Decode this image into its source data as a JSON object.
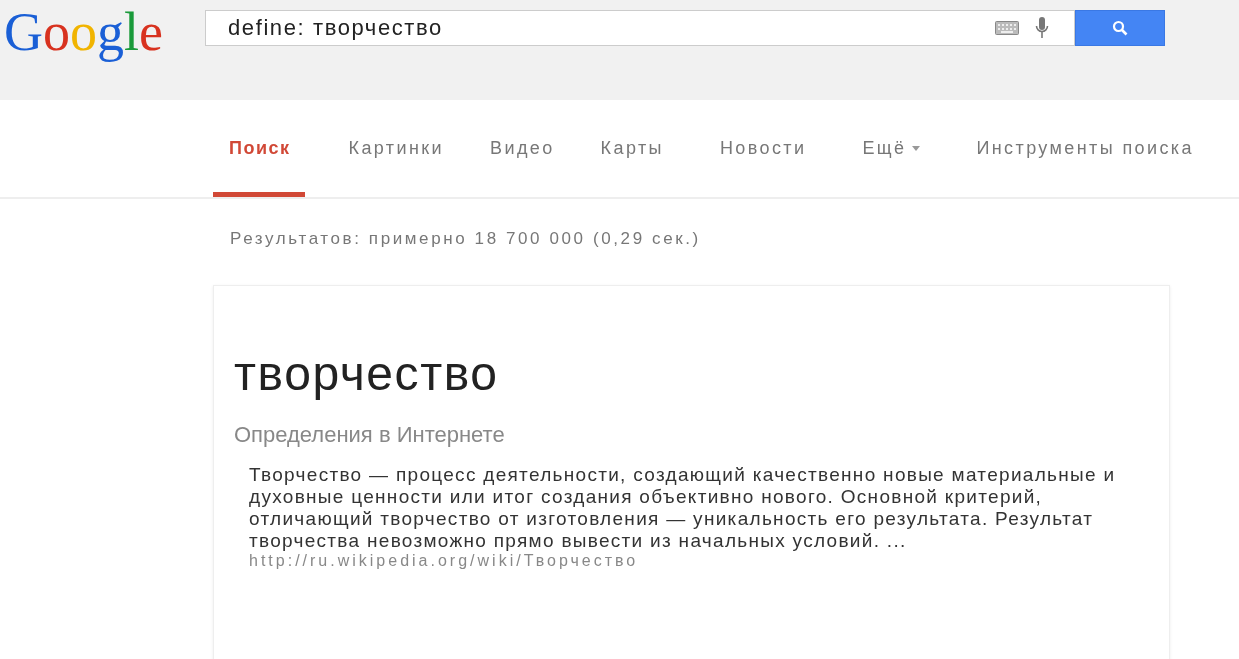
{
  "logo": "Google",
  "search": {
    "value": "define: творчество"
  },
  "tabs": [
    {
      "label": "Поиск",
      "selected": true,
      "kind": "tab"
    },
    {
      "label": "Картинки",
      "selected": false,
      "kind": "tab"
    },
    {
      "label": "Видео",
      "selected": false,
      "kind": "tab"
    },
    {
      "label": "Карты",
      "selected": false,
      "kind": "tab"
    },
    {
      "label": "Новости",
      "selected": false,
      "kind": "tab"
    },
    {
      "label": "Ещё",
      "selected": false,
      "kind": "menu"
    },
    {
      "label": "Инструменты поиска",
      "selected": false,
      "kind": "tools"
    }
  ],
  "result_stats": "Результатов: примерно 18 700 000 (0,29 сек.)",
  "definition": {
    "term": "творчество",
    "source_label": "Определения в Интернете",
    "text": "Творчество — процесс деятельности, создающий качественно новые материальные и духовные ценности или итог создания объективно нового. Основной критерий, отличающий творчество от изготовления — уникальность его результата. Результат творчества невозможно прямо вывести из начальных условий. ...",
    "url": "http://ru.wikipedia.org/wiki/Творчество"
  }
}
